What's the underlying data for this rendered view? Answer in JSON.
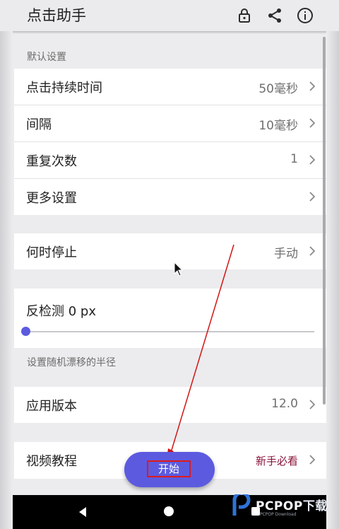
{
  "app": {
    "title": "点击助手"
  },
  "toolbar": {
    "lock_icon": "lock-icon",
    "share_icon": "share-icon",
    "info_icon": "info-icon"
  },
  "sections": {
    "defaults_label": "默认设置",
    "rows": [
      {
        "label": "点击持续时间",
        "value": "50毫秒"
      },
      {
        "label": "间隔",
        "value": "10毫秒"
      },
      {
        "label": "重复次数",
        "value": "1"
      },
      {
        "label": "更多设置",
        "value": ""
      }
    ],
    "stop": {
      "label": "何时停止",
      "value": "手动"
    },
    "anti_detect": {
      "label": "反检测 0 px",
      "slider_value": 0
    },
    "radius_label": "设置随机漂移的半径",
    "version": {
      "label": "应用版本",
      "value": "12.0"
    },
    "tutorial": {
      "label": "视频教程",
      "value": "新手必看"
    }
  },
  "fab": {
    "label": "开始"
  },
  "watermark": {
    "brand": "PCPOP",
    "cn": "下载",
    "sub": "PCPOP Download"
  },
  "colors": {
    "accent": "#5c5be0",
    "highlight": "#e01a1a",
    "link": "#8a1538"
  }
}
